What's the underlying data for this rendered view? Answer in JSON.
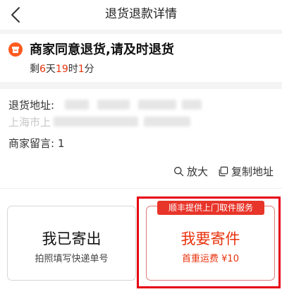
{
  "nav": {
    "title": "退货退款详情"
  },
  "status": {
    "title": "商家同意退货,请及时退货",
    "countdown_prefix": "剩",
    "days": "6",
    "days_unit": "天",
    "hours": "19",
    "hours_unit": "时",
    "minutes": "1",
    "minutes_unit": "分"
  },
  "address": {
    "label": "退货地址:",
    "line2_visible": "上海市上",
    "message_label": "商家留言:",
    "message_value": "1"
  },
  "actions": {
    "zoom_label": "放大",
    "copy_label": "复制地址"
  },
  "options": {
    "shipped": {
      "title": "我已寄出",
      "subtitle": "拍照填写快递单号"
    },
    "send": {
      "badge": "顺丰提供上门取件服务",
      "title": "我要寄件",
      "subtitle": "首重运费 ¥10"
    }
  },
  "colors": {
    "accent": "#e8320c",
    "icon_orange": "#ff5a1f",
    "highlight": "#e60012"
  }
}
